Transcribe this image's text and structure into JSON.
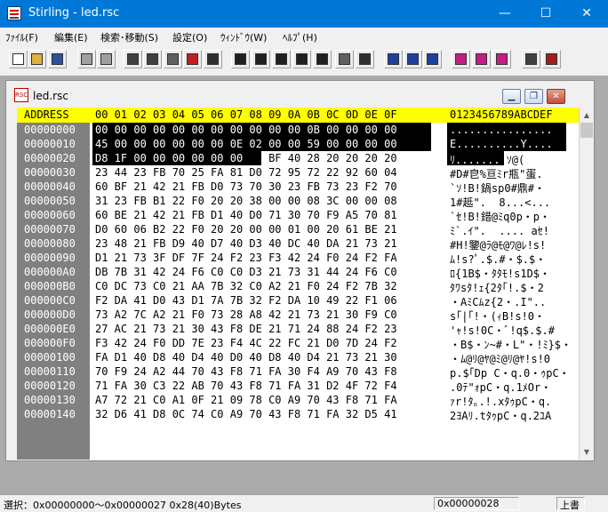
{
  "window": {
    "title": "Stirling - led.rsc",
    "minimize": "—",
    "maximize": "☐",
    "close": "✕"
  },
  "menu": [
    "ﾌｧｲﾙ(F)",
    "編集(E)",
    "検索･移動(S)",
    "設定(O)",
    "ｳｨﾝﾄﾞｳ(W)",
    "ﾍﾙﾌﾟ(H)"
  ],
  "toolbar": [
    "new-icon",
    "open-icon",
    "save-icon",
    "undo-icon",
    "redo-icon",
    "cut-icon",
    "copy-icon",
    "paste-icon",
    "delete-icon",
    "insert-list-icon",
    "find-icon",
    "find-next-icon",
    "find-prev-icon",
    "replace-icon",
    "replace-next-icon",
    "compare-icon",
    "bookmark-icon",
    "jump-top-icon",
    "jump-end-icon",
    "jump-address-icon",
    "mark-icon",
    "mark-next-icon",
    "mark-prev-icon",
    "print-icon",
    "help-book-icon"
  ],
  "child": {
    "title": "led.rsc",
    "icon_text": "RSC"
  },
  "header": {
    "address": "ADDRESS",
    "cols": "00 01 02 03 04 05 06 07 08 09 0A 0B 0C 0D 0E 0F",
    "chars": "0123456789ABCDEF"
  },
  "rows": [
    {
      "a": "00000000",
      "h": "00 00 00 00 00 00 00 00 00 00 00 0B 00 00 00 00",
      "c": "................"
    },
    {
      "a": "00000010",
      "h": "45 00 00 00 00 00 00 0E 02 00 00 59 00 00 00 00",
      "c": "E..........Y...."
    },
    {
      "a": "00000020",
      "h": "D8 1F 00 00 00 00 00 00 60 BF 40 28 20 20 20 20",
      "c": "ﾘ.......`ｿ@(    "
    },
    {
      "a": "00000030",
      "h": "23 44 23 FB 70 25 FA 81 D0 72 95 72 22 92 60 04",
      "c": "#D#皀%亘ﾐr瓶\"蛋."
    },
    {
      "a": "00000040",
      "h": "60 BF 21 42 21 FB D0 73 70 30 23 FB 73 23 F2 70",
      "c": "`ｿ!B!鍋sp0#鼎#・"
    },
    {
      "a": "00000050",
      "h": "31 23 FB B1 22 F0 20 20 38 00 00 08 3C 00 00 08",
      "c": "1#趆\".  8...<..."
    },
    {
      "a": "00000060",
      "h": "60 BE 21 42 21 FB D1 40 D0 71 30 70 F9 A5 70 81",
      "c": "`ｾ!B!錯@ﾐq0p・p・"
    },
    {
      "a": "00000070",
      "h": "D0 60 06 B2 22 F0 20 20 00 00 01 00 20 61 BE 21",
      "c": "ﾐ`.ｲ\".  .... aｾ!"
    },
    {
      "a": "00000080",
      "h": "23 48 21 FB D9 40 D7 40 D3 40 DC 40 DA 21 73 21",
      "c": "#H!鑒@ﾗ@ﾓ@ﾜ@ﾚ!s!"
    },
    {
      "a": "00000090",
      "h": "D1 21 73 3F DF 7F 24 F2 23 F3 42 24 F0 24 F2 FA",
      "c": "ﾑ!s?ﾟ.$.#・$.$・"
    },
    {
      "a": "000000A0",
      "h": "DB 7B 31 42 24 F6 C0 C0 D3 21 73 31 44 24 F6 C0",
      "c": "ﾛ{1B$・ﾀﾀﾓ!s1D$・"
    },
    {
      "a": "000000B0",
      "h": "C0 DC 73 C0 21 AA 7B 32 C0 A2 21 F0 24 F2 7B 32",
      "c": "ﾀﾜsﾀ!ｪ{2ﾀ｢!.$・2"
    },
    {
      "a": "000000C0",
      "h": "F2 DA 41 D0 43 D1 7A 7B 32 F2 DA 10 49 22 F1 06",
      "c": "・AﾐCﾑz{2・.I\".."
    },
    {
      "a": "000000D0",
      "h": "73 A2 7C A2 21 F0 73 28 A8 42 21 73 21 30 F9 C0",
      "c": "s｢|｢!・(ｨB!s!0・"
    },
    {
      "a": "000000E0",
      "h": "27 AC 21 73 21 30 43 F8 DE 21 71 24 88 24 F2 23",
      "c": "'ｬ!s!0C・ﾞ!q$.$.#"
    },
    {
      "a": "000000F0",
      "h": "F3 42 24 F0 DD 7E 23 F4 4C 22 FC 21 D0 7D 24 F2",
      "c": "・B$・ﾝ~#・L\"・!ﾐ}$・"
    },
    {
      "a": "00000100",
      "h": "FA D1 40 D8 40 D4 40 D0 40 D8 40 D4 21 73 21 30",
      "c": "・ﾑ@ﾘ@ﾔ@ﾐ@ﾘ@ﾔ!s!0"
    },
    {
      "a": "00000110",
      "h": "70 F9 24 A2 44 70 43 F8 71 FA 30 F4 A9 70 43 F8",
      "c": "p.$｢Dp C・q.0・ｩpC・"
    },
    {
      "a": "00000120",
      "h": "71 FA 30 C3 22 AB 70 43 F8 71 FA 31 D2 4F 72 F4",
      "c": ".0ﾃ\"ｫpC・q.1ﾒOr・"
    },
    {
      "a": "00000130",
      "h": "A7 72 21 C0 A1 0F 21 09 78 C0 A9 70 43 F8 71 FA",
      "c": "ｧr!ﾀ｡.!.xﾀｩpC・q."
    },
    {
      "a": "00000140",
      "h": "32 D6 41 D8 0C 74 C0 A9 70 43 F8 71 FA 32 D5 41",
      "c": "2ﾖAﾘ.tﾀｩpC・q.2ﾕA"
    }
  ],
  "status": {
    "selection": "選択：0x00000000～0x00000027  0x28(40)Bytes",
    "address": "0x00000028",
    "mode": "上書"
  }
}
